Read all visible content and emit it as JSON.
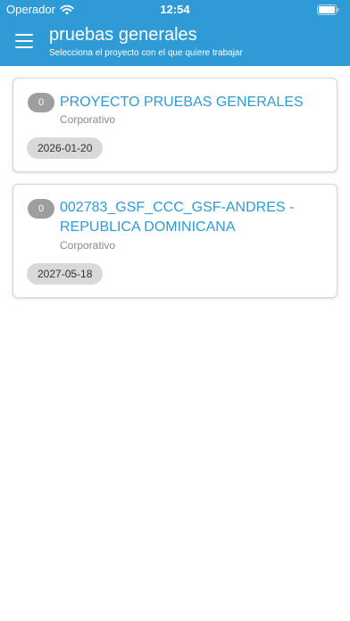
{
  "status_bar": {
    "carrier": "Operador",
    "time": "12:54"
  },
  "header": {
    "title": "pruebas generales",
    "subtitle": "Selecciona el proyecto con el que quiere trabajar"
  },
  "projects": [
    {
      "count": "0",
      "name": "PROYECTO PRUEBAS GENERALES",
      "type": "Corporativo",
      "date": "2026-01-20"
    },
    {
      "count": "0",
      "name": "002783_GSF_CCC_GSF-ANDRES - REPUBLICA DOMINICANA",
      "type": "Corporativo",
      "date": "2027-05-18"
    }
  ],
  "colors": {
    "accent": "#2e9bd6",
    "badge": "#9e9e9e",
    "chip": "#d9d9d9"
  },
  "icons": {
    "menu": "hamburger-menu-icon",
    "wifi": "wifi-icon",
    "battery": "battery-icon"
  }
}
